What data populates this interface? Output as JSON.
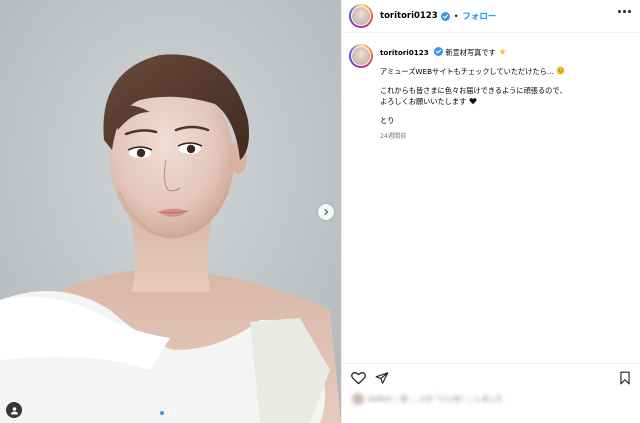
{
  "post": {
    "username": "toritori0123",
    "follow_label": "フォロー",
    "header_separator": "•",
    "caption_lines": [
      "新宣材写真です",
      "アミューズWEBサイトもチェックしていただけたら…",
      "これからも皆さまに色々お届けできるように頑張るので、",
      "よろしくお願いいたします",
      "とり"
    ],
    "timestamp": "24週間前",
    "likes_text": "toritori... 他 ... 人が「いいね！」しました"
  },
  "carousel": {
    "total": 3,
    "active_index": 0
  },
  "icons": {
    "verified": "verified-badge-icon",
    "more": "more-options-icon",
    "next": "chevron-right-icon",
    "tag": "user-tag-icon",
    "like": "heart-icon",
    "share": "paper-plane-icon",
    "save": "bookmark-icon"
  },
  "colors": {
    "accent": "#0095f6",
    "verified": "#3897f0",
    "text": "#000000",
    "muted": "#737373"
  }
}
